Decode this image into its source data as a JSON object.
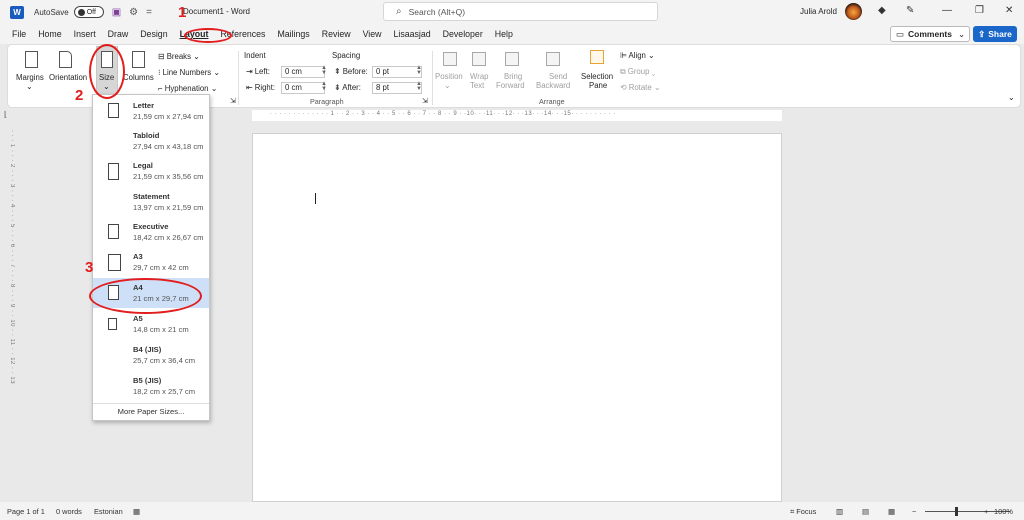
{
  "titlebar": {
    "app_badge": "W",
    "autosave_label": "AutoSave",
    "autosave_state": "Off",
    "doc_title": "Document1  -  Word",
    "search_placeholder": "Search (Alt+Q)",
    "user_name": "Julia Arold"
  },
  "menu": {
    "tabs": [
      "File",
      "Home",
      "Insert",
      "Draw",
      "Design",
      "Layout",
      "References",
      "Mailings",
      "Review",
      "View",
      "Lisaasjad",
      "Developer",
      "Help"
    ],
    "active_tab": "Layout",
    "comments_label": "Comments",
    "share_label": "Share"
  },
  "ribbon": {
    "margins": "Margins",
    "orientation": "Orientation",
    "size": "Size",
    "columns": "Columns",
    "breaks": "Breaks",
    "line_numbers": "Line Numbers",
    "hyphenation": "Hyphenation",
    "indent_title": "Indent",
    "spacing_title": "Spacing",
    "left_label": "Left:",
    "left_value": "0 cm",
    "right_label": "Right:",
    "right_value": "0 cm",
    "before_label": "Before:",
    "before_value": "0 pt",
    "after_label": "After:",
    "after_value": "8 pt",
    "position": "Position",
    "wrap_text_1": "Wrap",
    "wrap_text_2": "Text",
    "bring_forward_1": "Bring",
    "bring_forward_2": "Forward",
    "send_backward_1": "Send",
    "send_backward_2": "Backward",
    "selection_pane_1": "Selection",
    "selection_pane_2": "Pane",
    "align": "Align",
    "group": "Group",
    "rotate": "Rotate",
    "group_paragraph": "Paragraph",
    "group_arrange": "Arrange"
  },
  "size_menu": {
    "items": [
      {
        "name": "Letter",
        "dims": "21,59 cm x 27,94 cm"
      },
      {
        "name": "Tabloid",
        "dims": "27,94 cm x 43,18 cm"
      },
      {
        "name": "Legal",
        "dims": "21,59 cm x 35,56 cm"
      },
      {
        "name": "Statement",
        "dims": "13,97 cm x 21,59 cm"
      },
      {
        "name": "Executive",
        "dims": "18,42 cm x 26,67 cm"
      },
      {
        "name": "A3",
        "dims": "29,7 cm x 42 cm"
      },
      {
        "name": "A4",
        "dims": "21 cm x 29,7 cm"
      },
      {
        "name": "A5",
        "dims": "14,8 cm x 21 cm"
      },
      {
        "name": "B4 (JIS)",
        "dims": "25,7 cm x 36,4 cm"
      },
      {
        "name": "B5 (JIS)",
        "dims": "18,2 cm x 25,7 cm"
      }
    ],
    "selected": "A4",
    "more": "More Paper Sizes..."
  },
  "annotations": [
    "1",
    "2",
    "3"
  ],
  "ruler": {
    "horizontal": "· · · · · · · · · · · · · 1 · · 2 · · 3 · · 4 · · 5 · · 6 · · 7 · · 8 · · 9 · ·10· · ·11· · ·12· · ·13· · ·14· · ·15· · · · · · · · · ·",
    "vertical": "· · · 1 · · · 2 · · · 3 · · · 4 · · · 5 · · · 6 · · · 7 · · · 8 · · · 9 · · 10 · · 11 · · 12 · · 13"
  },
  "status": {
    "page": "Page 1 of 1",
    "words": "0 words",
    "language": "Estonian",
    "focus": "Focus",
    "zoom": "100%"
  },
  "colors": {
    "accent": "#185abd",
    "annotation": "#e21d1d",
    "selection": "#cde0f7"
  }
}
